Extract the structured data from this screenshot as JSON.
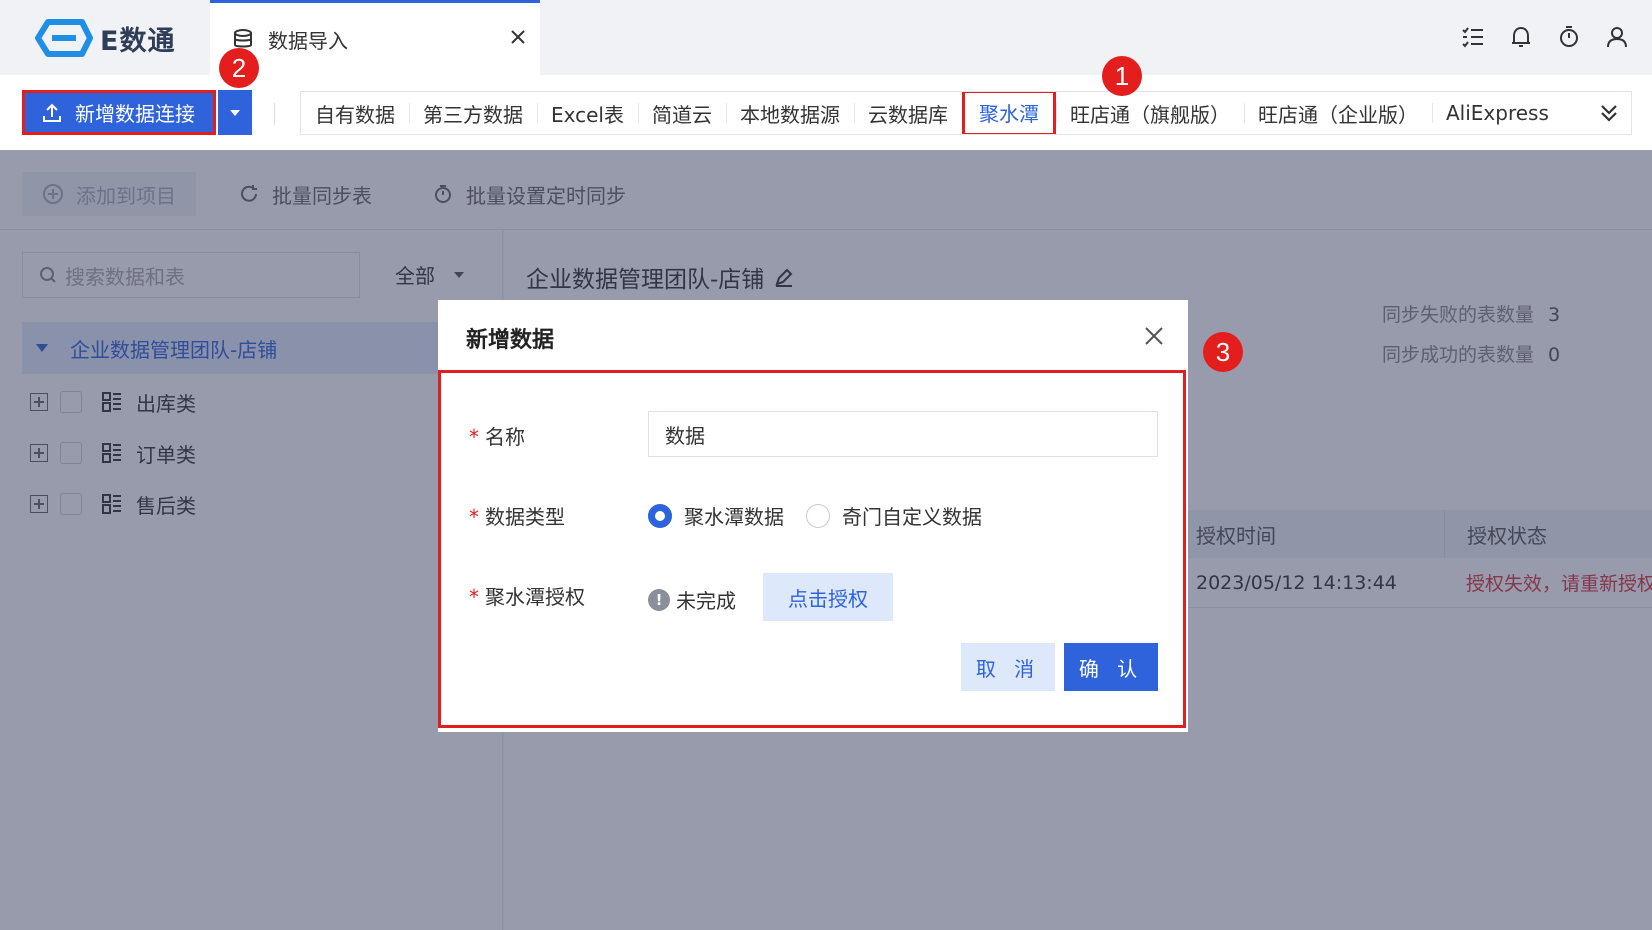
{
  "app": {
    "logo_text": "E数通",
    "active_tab": "数据导入"
  },
  "toolbar": {
    "add_connection_label": "新增数据连接",
    "source_tabs": [
      "自有数据",
      "第三方数据",
      "Excel表",
      "简道云",
      "本地数据源",
      "云数据库",
      "聚水潭",
      "旺店通（旗舰版）",
      "旺店通（企业版）",
      "AliExpress"
    ],
    "selected_source": "聚水潭"
  },
  "badges": {
    "b1": "1",
    "b2": "2",
    "b3": "3"
  },
  "actions": {
    "add_to_project": "添加到项目",
    "batch_sync": "批量同步表",
    "batch_schedule": "批量设置定时同步"
  },
  "left": {
    "search_placeholder": "搜索数据和表",
    "filter_value": "全部",
    "root": "企业数据管理团队-店铺",
    "items": [
      "出库类",
      "订单类",
      "售后类"
    ]
  },
  "right": {
    "title": "企业数据管理团队-店铺",
    "stat_fail_label": "同步失败的表数量",
    "stat_fail_value": "3",
    "stat_ok_label": "同步成功的表数量",
    "stat_ok_value": "0",
    "columns": [
      "授权时间",
      "授权状态"
    ],
    "row": [
      "2023/05/12 14:13:44",
      "授权失效，请重新授权"
    ]
  },
  "dialog": {
    "title": "新增数据",
    "name_label": "名称",
    "name_value": "数据",
    "type_label": "数据类型",
    "type_options": [
      "聚水潭数据",
      "奇门自定义数据"
    ],
    "type_selected": "聚水潭数据",
    "auth_label": "聚水潭授权",
    "auth_status": "未完成",
    "auth_button": "点击授权",
    "cancel": "取 消",
    "confirm": "确 认"
  },
  "colors": {
    "accent": "#2e63dc",
    "highlight": "#e02020",
    "error": "#d9363e"
  }
}
